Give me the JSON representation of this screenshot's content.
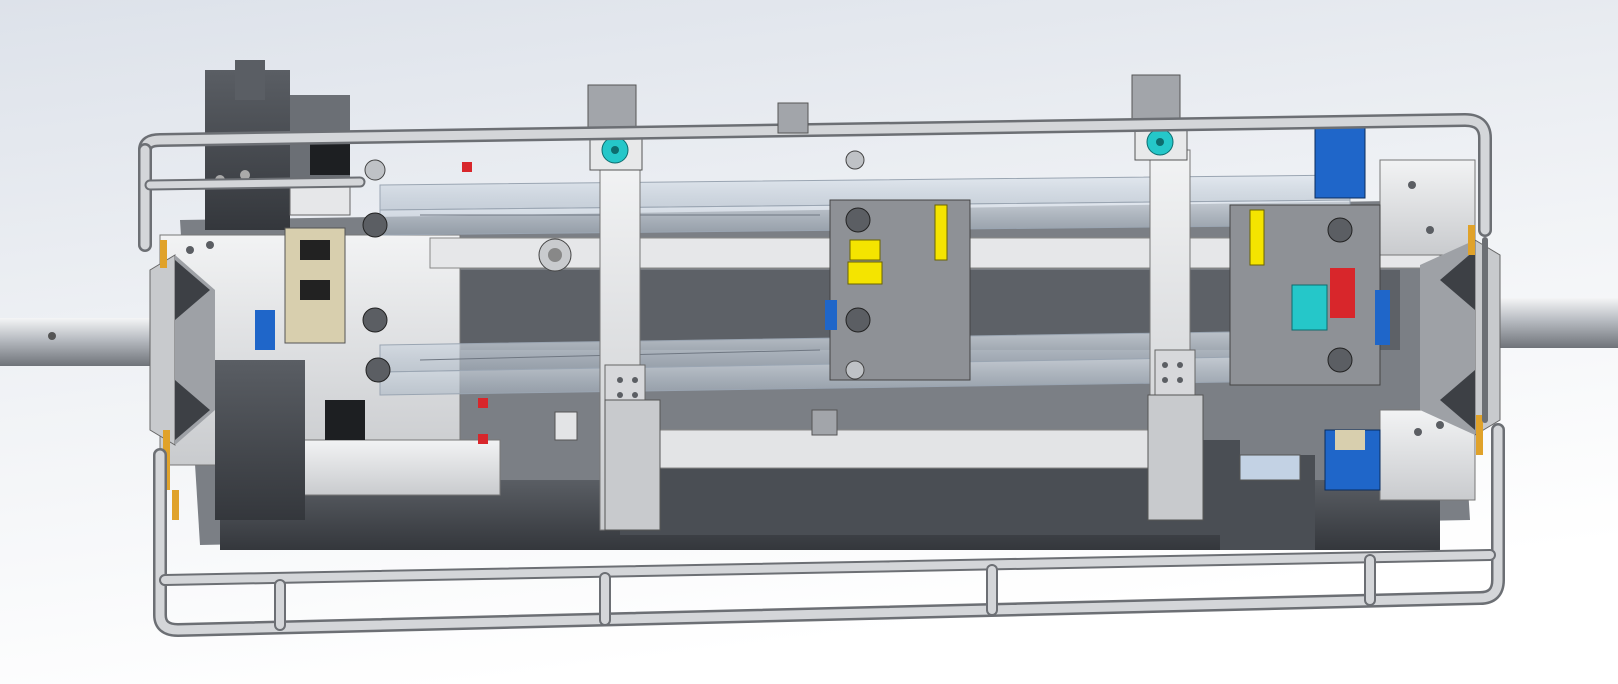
{
  "viewport": {
    "background_top": "#dfe4ec",
    "background_bottom": "#ffffff"
  },
  "colors": {
    "frame_tube": "#c6c8cc",
    "frame_tube_edge": "#6c6f74",
    "dark_metal": "#3f4247",
    "mid_metal": "#8b8e93",
    "light_metal": "#d3d5d8",
    "plate_white": "#e9eaec",
    "translucent_rail": "#c8d3df",
    "accent_cyan": "#25c7c9",
    "accent_yellow": "#f4e400",
    "accent_blue": "#1f66c9",
    "accent_red": "#d8262b",
    "accent_orange": "#e0a22a",
    "accent_beige": "#d8cfae"
  },
  "model": {
    "description_icon": "cad-assembly-icon"
  }
}
